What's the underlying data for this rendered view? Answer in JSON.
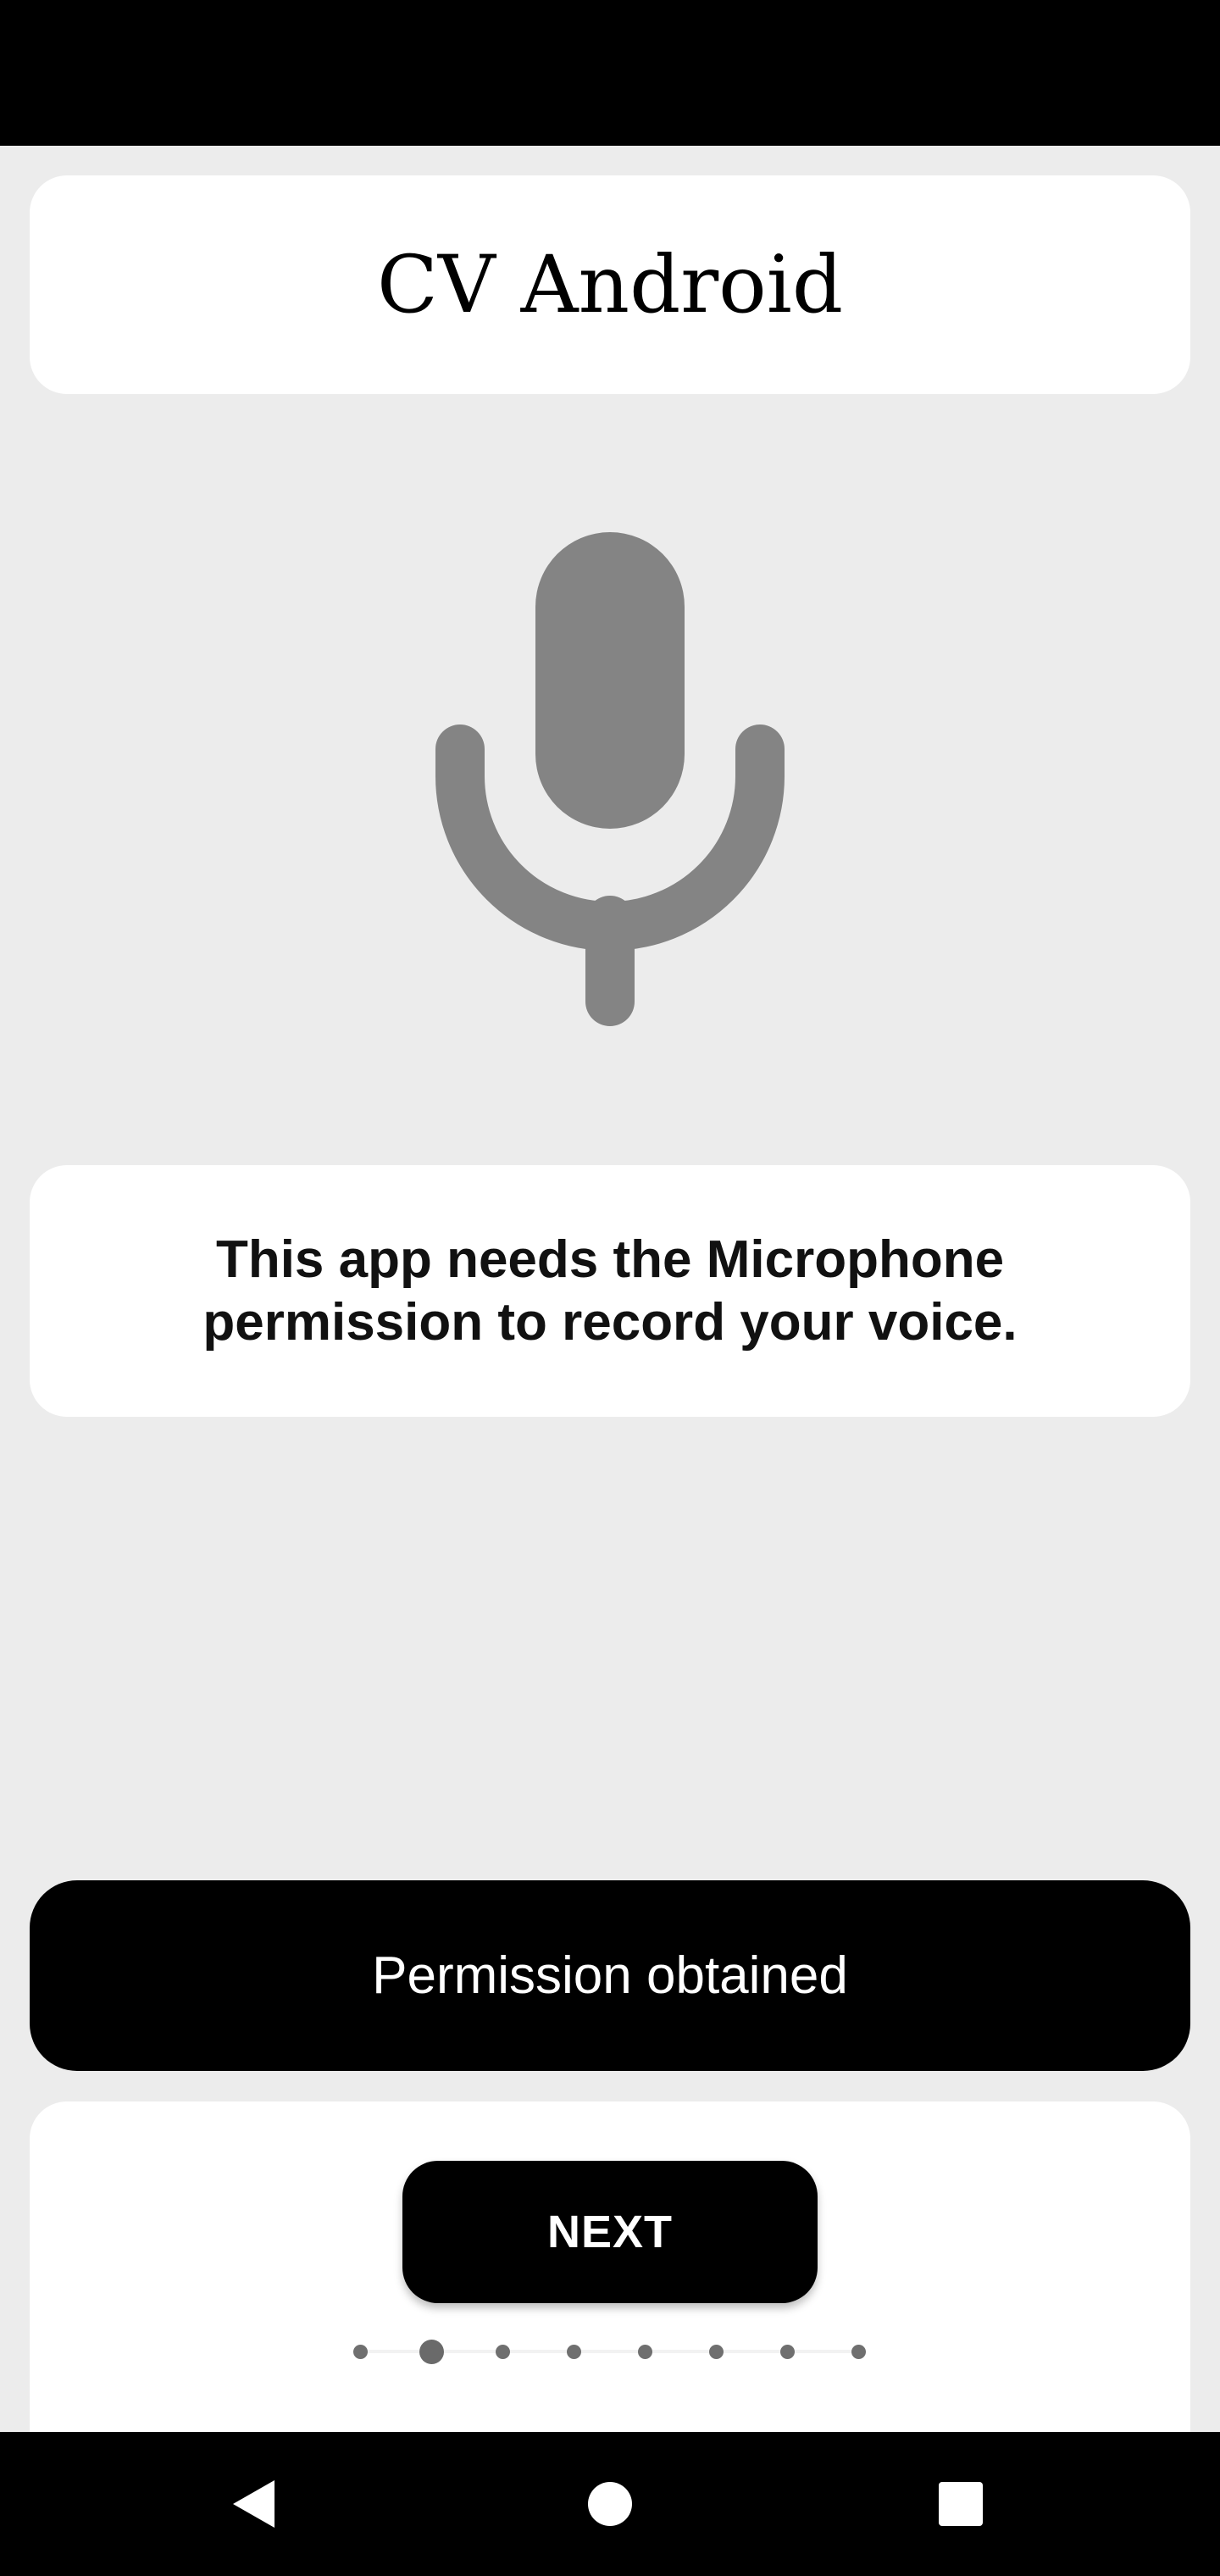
{
  "header": {
    "app_title": "CV Android"
  },
  "hero": {
    "icon": "microphone-icon",
    "icon_color": "#848484"
  },
  "info": {
    "message": "This app needs the Microphone permission to record your voice."
  },
  "permission_button": {
    "label": "Permission obtained"
  },
  "onboarding": {
    "next_label": "NEXT",
    "page_count": 8,
    "current_page": 2
  },
  "navigation": {
    "back_icon": "back-triangle-icon",
    "home_icon": "home-circle-icon",
    "recents_icon": "recents-square-icon"
  },
  "colors": {
    "background": "#ececec",
    "card": "#ffffff",
    "button": "#000000",
    "dot": "#6f6f6f"
  }
}
